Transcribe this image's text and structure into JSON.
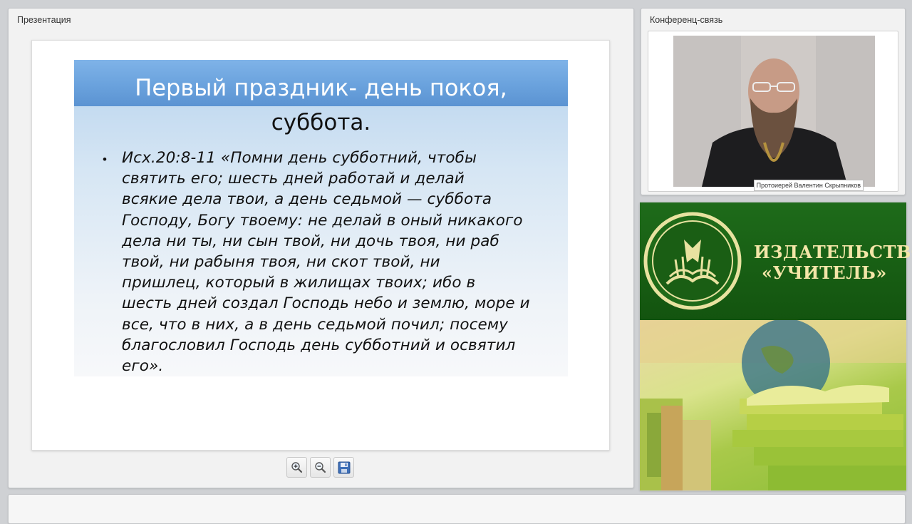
{
  "presentation_panel": {
    "title": "Презентация",
    "slide": {
      "title_line1": "Первый праздник- день покоя,",
      "title_line2": "суббота.",
      "bullet": "•",
      "text_lines": [
        "Исх.20:8-11 «Помни день субботний, чтобы",
        "святить его; шесть дней работай и делай",
        "всякие дела твои, а день седьмой — суббота",
        "Господу, Богу твоему: не делай в оный никакого",
        "дела ни ты, ни сын твой, ни дочь твоя, ни раб",
        "твой, ни рабыня твоя, ни скот твой, ни",
        "пришлец, который в жилищах твоих; ибо в",
        "шесть дней создал Господь небо и землю, море и",
        "все, что в них, а в день седьмой почил; посему",
        "благословил Господь день субботний и освятил",
        "его»."
      ]
    },
    "toolbar": {
      "zoom_in_icon": "zoom-in-icon",
      "zoom_out_icon": "zoom-out-icon",
      "save_icon": "floppy-disk-icon"
    }
  },
  "conference_panel": {
    "title": "Конференц-связь",
    "speaker_caption": "Протоиерей Валентин Скрыпников"
  },
  "publisher_banner": {
    "line1": "ИЗДАТЕЛЬСТВО",
    "line2": "«УЧИТЕЛЬ»"
  },
  "colors": {
    "slide_band": "#6aa2dd",
    "banner_green": "#1e6b1a",
    "banner_text": "#f4e6a8"
  }
}
